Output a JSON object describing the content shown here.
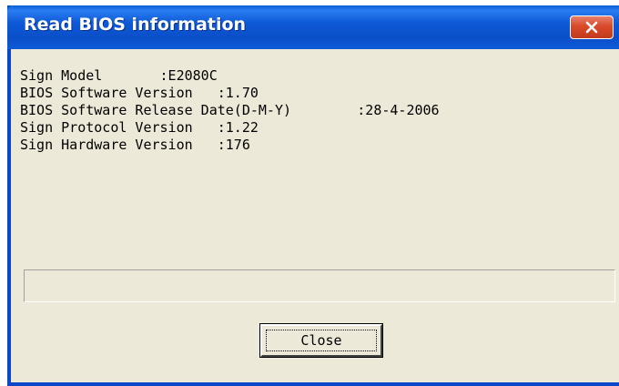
{
  "window": {
    "title": "Read BIOS information"
  },
  "info": {
    "lines": [
      "Sign Model       :E2080C",
      "BIOS Software Version   :1.70",
      "BIOS Software Release Date(D-M-Y)        :28-4-2006",
      "Sign Protocol Version   :1.22",
      "Sign Hardware Version   :176"
    ]
  },
  "buttons": {
    "close_label": "Close"
  },
  "icons": {
    "title_close": "close-icon"
  },
  "colors": {
    "titlebar": "#0a4fc8",
    "close_button": "#d84a2a",
    "face": "#ece9d8"
  }
}
